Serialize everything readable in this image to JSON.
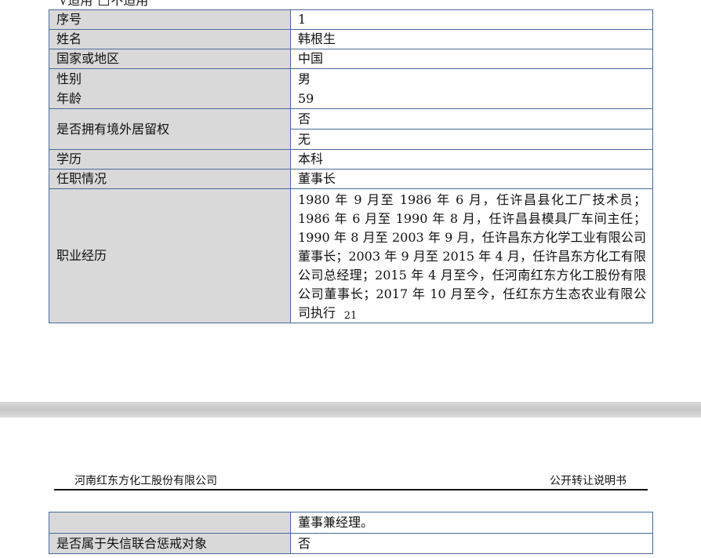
{
  "page1": {
    "applicable": {
      "yes": "√适用",
      "no": "不适用"
    },
    "rows": {
      "seq": {
        "label": "序号",
        "value": "1"
      },
      "name": {
        "label": "姓名",
        "value": "韩根生"
      },
      "country": {
        "label": "国家或地区",
        "value": "中国"
      },
      "gender": {
        "label": "性别",
        "value": "男"
      },
      "age": {
        "label": "年龄",
        "value": "59"
      },
      "overseas": {
        "label": "是否拥有境外居留权",
        "value1": "否",
        "value2": "无"
      },
      "education": {
        "label": "学历",
        "value": "本科"
      },
      "position": {
        "label": "任职情况",
        "value": "董事长"
      },
      "career": {
        "label": "职业经历",
        "value": "1980 年 9 月至 1986 年 6 月，任许昌县化工厂技术员；1986 年 6 月至 1990 年 8 月，任许昌县模具厂车间主任；1990 年 8 月至 2003 年 9 月，任许昌东方化学工业有限公司董事长；2003 年 9 月至 2015 年 4 月，任许昌东方化工有限公司总经理；2015 年 4 月至今，任河南红东方化工股份有限公司董事长；2017 年 10 月至今，任红东方生态农业有限公司执行"
      }
    },
    "page_number": "21"
  },
  "page2": {
    "header": {
      "company": "河南红东方化工股份有限公司",
      "doc_type": "公开转让说明书"
    },
    "rows": {
      "career_cont": {
        "value": "董事兼经理。"
      },
      "dishonest": {
        "label": "是否属于失信联合惩戒对象",
        "value": "否"
      }
    }
  }
}
